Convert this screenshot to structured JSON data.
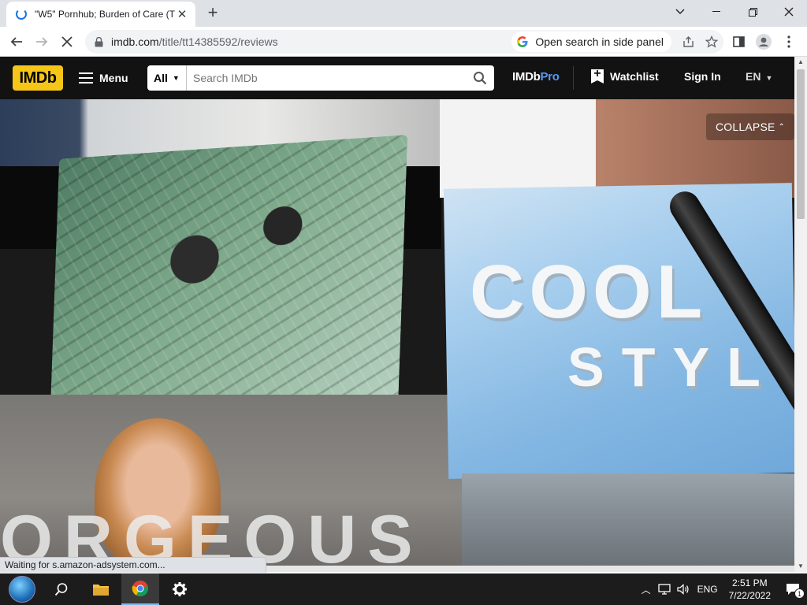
{
  "browser": {
    "tab_title": "\"W5\" Pornhub; Burden of Care (T",
    "url_host": "imdb.com",
    "url_path": "/title/tt14385592/reviews",
    "side_panel_label": "Open search in side panel",
    "status_text": "Waiting for s.amazon-adsystem.com..."
  },
  "imdb": {
    "logo": "IMDb",
    "menu_label": "Menu",
    "search_category": "All",
    "search_placeholder": "Search IMDb",
    "search_value": "",
    "pro_prefix": "IMDb",
    "pro_suffix": "Pro",
    "watchlist_label": "Watchlist",
    "signin_label": "Sign In",
    "language": "EN"
  },
  "hero": {
    "collapse_label": "COLLAPSE",
    "overlay_text_left": "ORGEOUS",
    "overlay_text_cool": "COOL",
    "overlay_text_style": "STYL"
  },
  "taskbar": {
    "language": "ENG",
    "time": "2:51 PM",
    "date": "7/22/2022",
    "notification_count": "1"
  },
  "colors": {
    "imdb_yellow": "#f5c518",
    "imdb_header": "#121212",
    "imdbpro_blue": "#5799ef",
    "chrome_tabstrip": "#dee1e6",
    "taskbar": "#1c1c1c"
  }
}
